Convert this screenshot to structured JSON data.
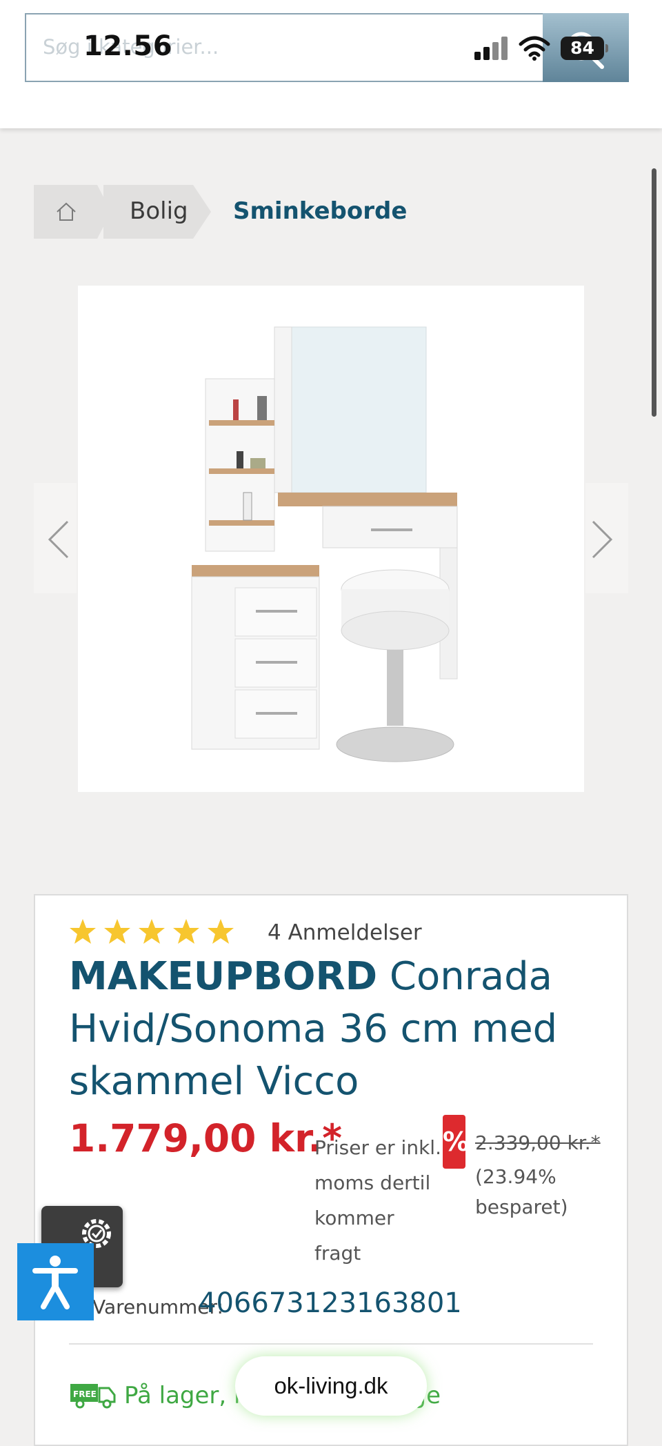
{
  "status_bar": {
    "time": "12.56",
    "battery": "84"
  },
  "search": {
    "placeholder": "Søg i kategorier..."
  },
  "breadcrumb": {
    "level1": "Bolig",
    "current": "Sminkeborde"
  },
  "product": {
    "reviews": "4 Anmeldelser",
    "rating": 5,
    "title_bold": "MAKEUPBORD",
    "title_rest": " Conrada Hvid/Sonoma 36 cm med skammel Vicco",
    "price": "1.779,00 kr.*",
    "price_note": "Priser er inkl. moms dertil kommer fragt",
    "discount_badge": "%",
    "old_price": "2.339,00 kr.*",
    "saved": "(23.94% besparet)",
    "item_number_label": "Varenummer:",
    "item_number": "406673123163801",
    "stock": "På lager, levering 2-4 dage"
  },
  "url_pill": "ok-living.dk",
  "colors": {
    "brand_blue": "#14536f",
    "price_red": "#d3232a",
    "stock_green": "#3fa843",
    "accessibility_blue": "#1c8ede"
  }
}
